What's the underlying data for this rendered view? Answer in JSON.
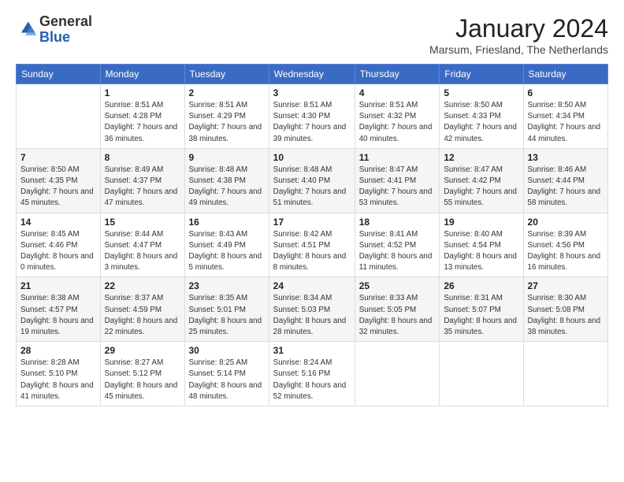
{
  "logo": {
    "general": "General",
    "blue": "Blue"
  },
  "header": {
    "month_title": "January 2024",
    "subtitle": "Marsum, Friesland, The Netherlands"
  },
  "days_of_week": [
    "Sunday",
    "Monday",
    "Tuesday",
    "Wednesday",
    "Thursday",
    "Friday",
    "Saturday"
  ],
  "weeks": [
    [
      {
        "day": "",
        "sunrise": "",
        "sunset": "",
        "daylight": ""
      },
      {
        "day": "1",
        "sunrise": "Sunrise: 8:51 AM",
        "sunset": "Sunset: 4:28 PM",
        "daylight": "Daylight: 7 hours and 36 minutes."
      },
      {
        "day": "2",
        "sunrise": "Sunrise: 8:51 AM",
        "sunset": "Sunset: 4:29 PM",
        "daylight": "Daylight: 7 hours and 38 minutes."
      },
      {
        "day": "3",
        "sunrise": "Sunrise: 8:51 AM",
        "sunset": "Sunset: 4:30 PM",
        "daylight": "Daylight: 7 hours and 39 minutes."
      },
      {
        "day": "4",
        "sunrise": "Sunrise: 8:51 AM",
        "sunset": "Sunset: 4:32 PM",
        "daylight": "Daylight: 7 hours and 40 minutes."
      },
      {
        "day": "5",
        "sunrise": "Sunrise: 8:50 AM",
        "sunset": "Sunset: 4:33 PM",
        "daylight": "Daylight: 7 hours and 42 minutes."
      },
      {
        "day": "6",
        "sunrise": "Sunrise: 8:50 AM",
        "sunset": "Sunset: 4:34 PM",
        "daylight": "Daylight: 7 hours and 44 minutes."
      }
    ],
    [
      {
        "day": "7",
        "sunrise": "Sunrise: 8:50 AM",
        "sunset": "Sunset: 4:35 PM",
        "daylight": "Daylight: 7 hours and 45 minutes."
      },
      {
        "day": "8",
        "sunrise": "Sunrise: 8:49 AM",
        "sunset": "Sunset: 4:37 PM",
        "daylight": "Daylight: 7 hours and 47 minutes."
      },
      {
        "day": "9",
        "sunrise": "Sunrise: 8:48 AM",
        "sunset": "Sunset: 4:38 PM",
        "daylight": "Daylight: 7 hours and 49 minutes."
      },
      {
        "day": "10",
        "sunrise": "Sunrise: 8:48 AM",
        "sunset": "Sunset: 4:40 PM",
        "daylight": "Daylight: 7 hours and 51 minutes."
      },
      {
        "day": "11",
        "sunrise": "Sunrise: 8:47 AM",
        "sunset": "Sunset: 4:41 PM",
        "daylight": "Daylight: 7 hours and 53 minutes."
      },
      {
        "day": "12",
        "sunrise": "Sunrise: 8:47 AM",
        "sunset": "Sunset: 4:42 PM",
        "daylight": "Daylight: 7 hours and 55 minutes."
      },
      {
        "day": "13",
        "sunrise": "Sunrise: 8:46 AM",
        "sunset": "Sunset: 4:44 PM",
        "daylight": "Daylight: 7 hours and 58 minutes."
      }
    ],
    [
      {
        "day": "14",
        "sunrise": "Sunrise: 8:45 AM",
        "sunset": "Sunset: 4:46 PM",
        "daylight": "Daylight: 8 hours and 0 minutes."
      },
      {
        "day": "15",
        "sunrise": "Sunrise: 8:44 AM",
        "sunset": "Sunset: 4:47 PM",
        "daylight": "Daylight: 8 hours and 3 minutes."
      },
      {
        "day": "16",
        "sunrise": "Sunrise: 8:43 AM",
        "sunset": "Sunset: 4:49 PM",
        "daylight": "Daylight: 8 hours and 5 minutes."
      },
      {
        "day": "17",
        "sunrise": "Sunrise: 8:42 AM",
        "sunset": "Sunset: 4:51 PM",
        "daylight": "Daylight: 8 hours and 8 minutes."
      },
      {
        "day": "18",
        "sunrise": "Sunrise: 8:41 AM",
        "sunset": "Sunset: 4:52 PM",
        "daylight": "Daylight: 8 hours and 11 minutes."
      },
      {
        "day": "19",
        "sunrise": "Sunrise: 8:40 AM",
        "sunset": "Sunset: 4:54 PM",
        "daylight": "Daylight: 8 hours and 13 minutes."
      },
      {
        "day": "20",
        "sunrise": "Sunrise: 8:39 AM",
        "sunset": "Sunset: 4:56 PM",
        "daylight": "Daylight: 8 hours and 16 minutes."
      }
    ],
    [
      {
        "day": "21",
        "sunrise": "Sunrise: 8:38 AM",
        "sunset": "Sunset: 4:57 PM",
        "daylight": "Daylight: 8 hours and 19 minutes."
      },
      {
        "day": "22",
        "sunrise": "Sunrise: 8:37 AM",
        "sunset": "Sunset: 4:59 PM",
        "daylight": "Daylight: 8 hours and 22 minutes."
      },
      {
        "day": "23",
        "sunrise": "Sunrise: 8:35 AM",
        "sunset": "Sunset: 5:01 PM",
        "daylight": "Daylight: 8 hours and 25 minutes."
      },
      {
        "day": "24",
        "sunrise": "Sunrise: 8:34 AM",
        "sunset": "Sunset: 5:03 PM",
        "daylight": "Daylight: 8 hours and 28 minutes."
      },
      {
        "day": "25",
        "sunrise": "Sunrise: 8:33 AM",
        "sunset": "Sunset: 5:05 PM",
        "daylight": "Daylight: 8 hours and 32 minutes."
      },
      {
        "day": "26",
        "sunrise": "Sunrise: 8:31 AM",
        "sunset": "Sunset: 5:07 PM",
        "daylight": "Daylight: 8 hours and 35 minutes."
      },
      {
        "day": "27",
        "sunrise": "Sunrise: 8:30 AM",
        "sunset": "Sunset: 5:08 PM",
        "daylight": "Daylight: 8 hours and 38 minutes."
      }
    ],
    [
      {
        "day": "28",
        "sunrise": "Sunrise: 8:28 AM",
        "sunset": "Sunset: 5:10 PM",
        "daylight": "Daylight: 8 hours and 41 minutes."
      },
      {
        "day": "29",
        "sunrise": "Sunrise: 8:27 AM",
        "sunset": "Sunset: 5:12 PM",
        "daylight": "Daylight: 8 hours and 45 minutes."
      },
      {
        "day": "30",
        "sunrise": "Sunrise: 8:25 AM",
        "sunset": "Sunset: 5:14 PM",
        "daylight": "Daylight: 8 hours and 48 minutes."
      },
      {
        "day": "31",
        "sunrise": "Sunrise: 8:24 AM",
        "sunset": "Sunset: 5:16 PM",
        "daylight": "Daylight: 8 hours and 52 minutes."
      },
      {
        "day": "",
        "sunrise": "",
        "sunset": "",
        "daylight": ""
      },
      {
        "day": "",
        "sunrise": "",
        "sunset": "",
        "daylight": ""
      },
      {
        "day": "",
        "sunrise": "",
        "sunset": "",
        "daylight": ""
      }
    ]
  ]
}
